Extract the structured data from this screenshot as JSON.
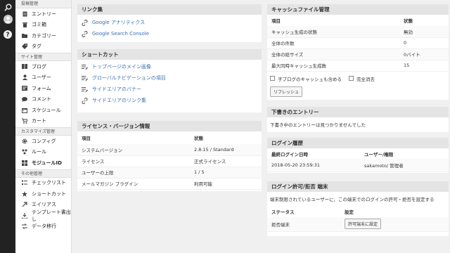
{
  "sidebar": {
    "sections": [
      {
        "title": "投稿管理",
        "items": [
          "エントリー",
          "ゴミ箱",
          "カテゴリー",
          "タグ"
        ]
      },
      {
        "title": "サイト管理",
        "items": [
          "ブログ",
          "ユーザー",
          "フォーム",
          "コメント",
          "スケジュール",
          "カート"
        ]
      },
      {
        "title": "カスタマイズ管理",
        "items": [
          "コンフィグ",
          "ルール",
          "モジュールID"
        ]
      },
      {
        "title": "その他管理",
        "items": [
          "チェックリスト",
          "ショートカット",
          "エイリアス",
          "テンプレート書出し",
          "データ移行"
        ]
      }
    ]
  },
  "links": {
    "title": "リンク集",
    "items": [
      "Google アナリティクス",
      "Google Search Console"
    ]
  },
  "shortcuts": {
    "title": "ショートカット",
    "items": [
      "トップページのメイン画像",
      "グローバルナビゲーションの項目",
      "サイドエリアのバナー",
      "サイドエリアのリンク集"
    ]
  },
  "license": {
    "title": "ライセンス・バージョン情報",
    "headers": [
      "項目",
      "状態"
    ],
    "rows": [
      [
        "システムバージョン",
        "2.8.15 / Standard"
      ],
      [
        "ライセンス",
        "正式ライセンス"
      ],
      [
        "ユーザーの上限",
        "1 / 5"
      ],
      [
        "メールマガジン プラグイン",
        "利用可能"
      ]
    ]
  },
  "cache": {
    "title": "キャッシュファイル管理",
    "headers": [
      "項目",
      "状態"
    ],
    "rows": [
      [
        "キャッシュ生成の状態",
        "無効"
      ],
      [
        "全体の件数",
        "0"
      ],
      [
        "全体の総サイズ",
        "0バイト"
      ],
      [
        "最大同時キャッシュ生成数",
        "15"
      ]
    ],
    "check_child": "子ブログのキャッシュも含める",
    "check_full": "完全消去",
    "refresh": "リフレッシュ"
  },
  "drafts": {
    "title": "下書きのエントリー",
    "message": "下書き中のエントリーは見つかりませんでした"
  },
  "login_history": {
    "title": "ログイン履歴",
    "headers": [
      "最終ログイン日時",
      "ユーザー/権限"
    ],
    "rows": [
      [
        "2018-05-20 23:59:31",
        "sakamoto/ 管理者"
      ]
    ]
  },
  "login_permission": {
    "title": "ログイン許可/拒否 端末",
    "message": "端末制限されているユーザーに、この端末でのログインの許可・拒否を設定する",
    "headers": [
      "ステータス",
      "設定"
    ],
    "rows": [
      [
        "拒否端末",
        "許可端末に設定"
      ]
    ]
  }
}
